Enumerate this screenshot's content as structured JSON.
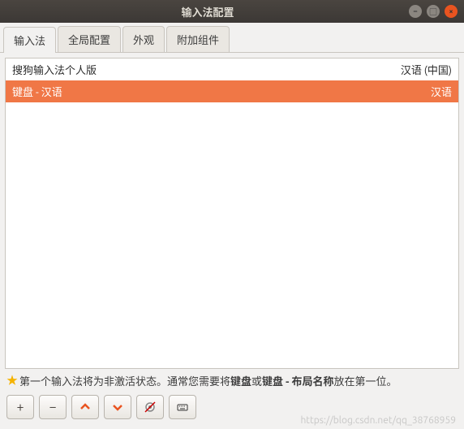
{
  "window": {
    "title": "输入法配置"
  },
  "tabs": [
    {
      "label": "输入法"
    },
    {
      "label": "全局配置"
    },
    {
      "label": "外观"
    },
    {
      "label": "附加组件"
    }
  ],
  "list": {
    "rows": [
      {
        "name": "搜狗输入法个人版",
        "lang": "汉语 (中国)"
      },
      {
        "name": "键盘 - 汉语",
        "lang": "汉语"
      }
    ]
  },
  "hint": {
    "prefix": "第一个输入法将为非激活状态。通常您需要将",
    "bold1": "键盘",
    "mid": "或",
    "bold2": "键盘 - 布局名称",
    "suffix": "放在第一位。"
  },
  "toolbar": {
    "add": "+",
    "remove": "−"
  },
  "watermark": "https://blog.csdn.net/qq_38768959"
}
